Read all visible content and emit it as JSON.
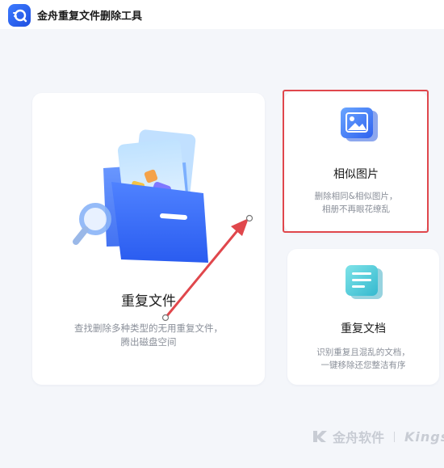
{
  "app": {
    "title": "金舟重复文件删除工具"
  },
  "cards": {
    "duplicate_files": {
      "title": "重复文件",
      "desc_line1": "查找删除多种类型的无用重复文件，",
      "desc_line2": "腾出磁盘空间",
      "icon": "folder-icon"
    },
    "similar_images": {
      "title": "相似图片",
      "desc_line1": "删除相同&相似图片，",
      "desc_line2": "相册不再眼花缭乱",
      "icon": "image-icon"
    },
    "duplicate_docs": {
      "title": "重复文档",
      "desc_line1": "识别重复且混乱的文档，",
      "desc_line2": "一键移除还您整洁有序",
      "icon": "document-icon"
    }
  },
  "watermark": {
    "brand_cn": "金舟软件",
    "brand_en": "Kings"
  },
  "colors": {
    "accent": "#3d7bff",
    "highlight": "#e0474c",
    "annotation_arrow": "#e0474c"
  }
}
